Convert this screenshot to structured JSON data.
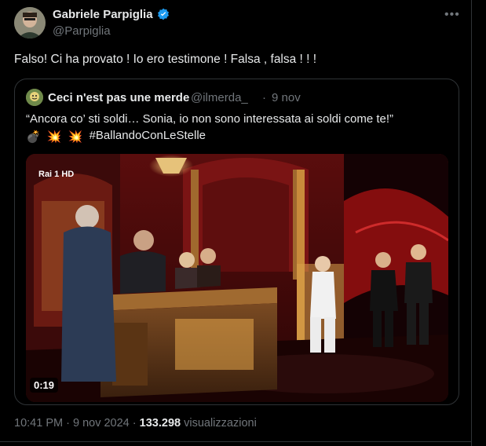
{
  "tweet": {
    "author": {
      "name": "Gabriele Parpiglia",
      "handle": "@Parpiglia"
    },
    "text": "Falso! Ci ha provato ! Io ero testimone ! Falsa , falsa ! ! !",
    "time": "10:41 PM",
    "date": "9 nov 2024",
    "views": "133.298",
    "views_label": "visualizzazioni",
    "sep": "·"
  },
  "quote": {
    "author": {
      "name": "Ceci n'est pas une merde",
      "handle": "@ilmerda_"
    },
    "date": "9 nov",
    "sep": "·",
    "line1": "“Ancora co’ sti soldi… Sonia, io non sono interessata ai soldi come te!”",
    "hashtag": "#BallandoConLeStelle",
    "emojis": [
      "💣",
      "💥",
      "💥"
    ],
    "video": {
      "duration": "0:19",
      "channel_logo": "Rai 1 HD"
    }
  },
  "colors": {
    "bg": "#000000",
    "text": "#e7e9ea",
    "muted": "#71767b",
    "verified": "#1d9bf0",
    "border": "#2f3336"
  },
  "icons": [
    "verified-badge-icon",
    "more-options-icon",
    "bomb-icon",
    "explosion-icon"
  ]
}
